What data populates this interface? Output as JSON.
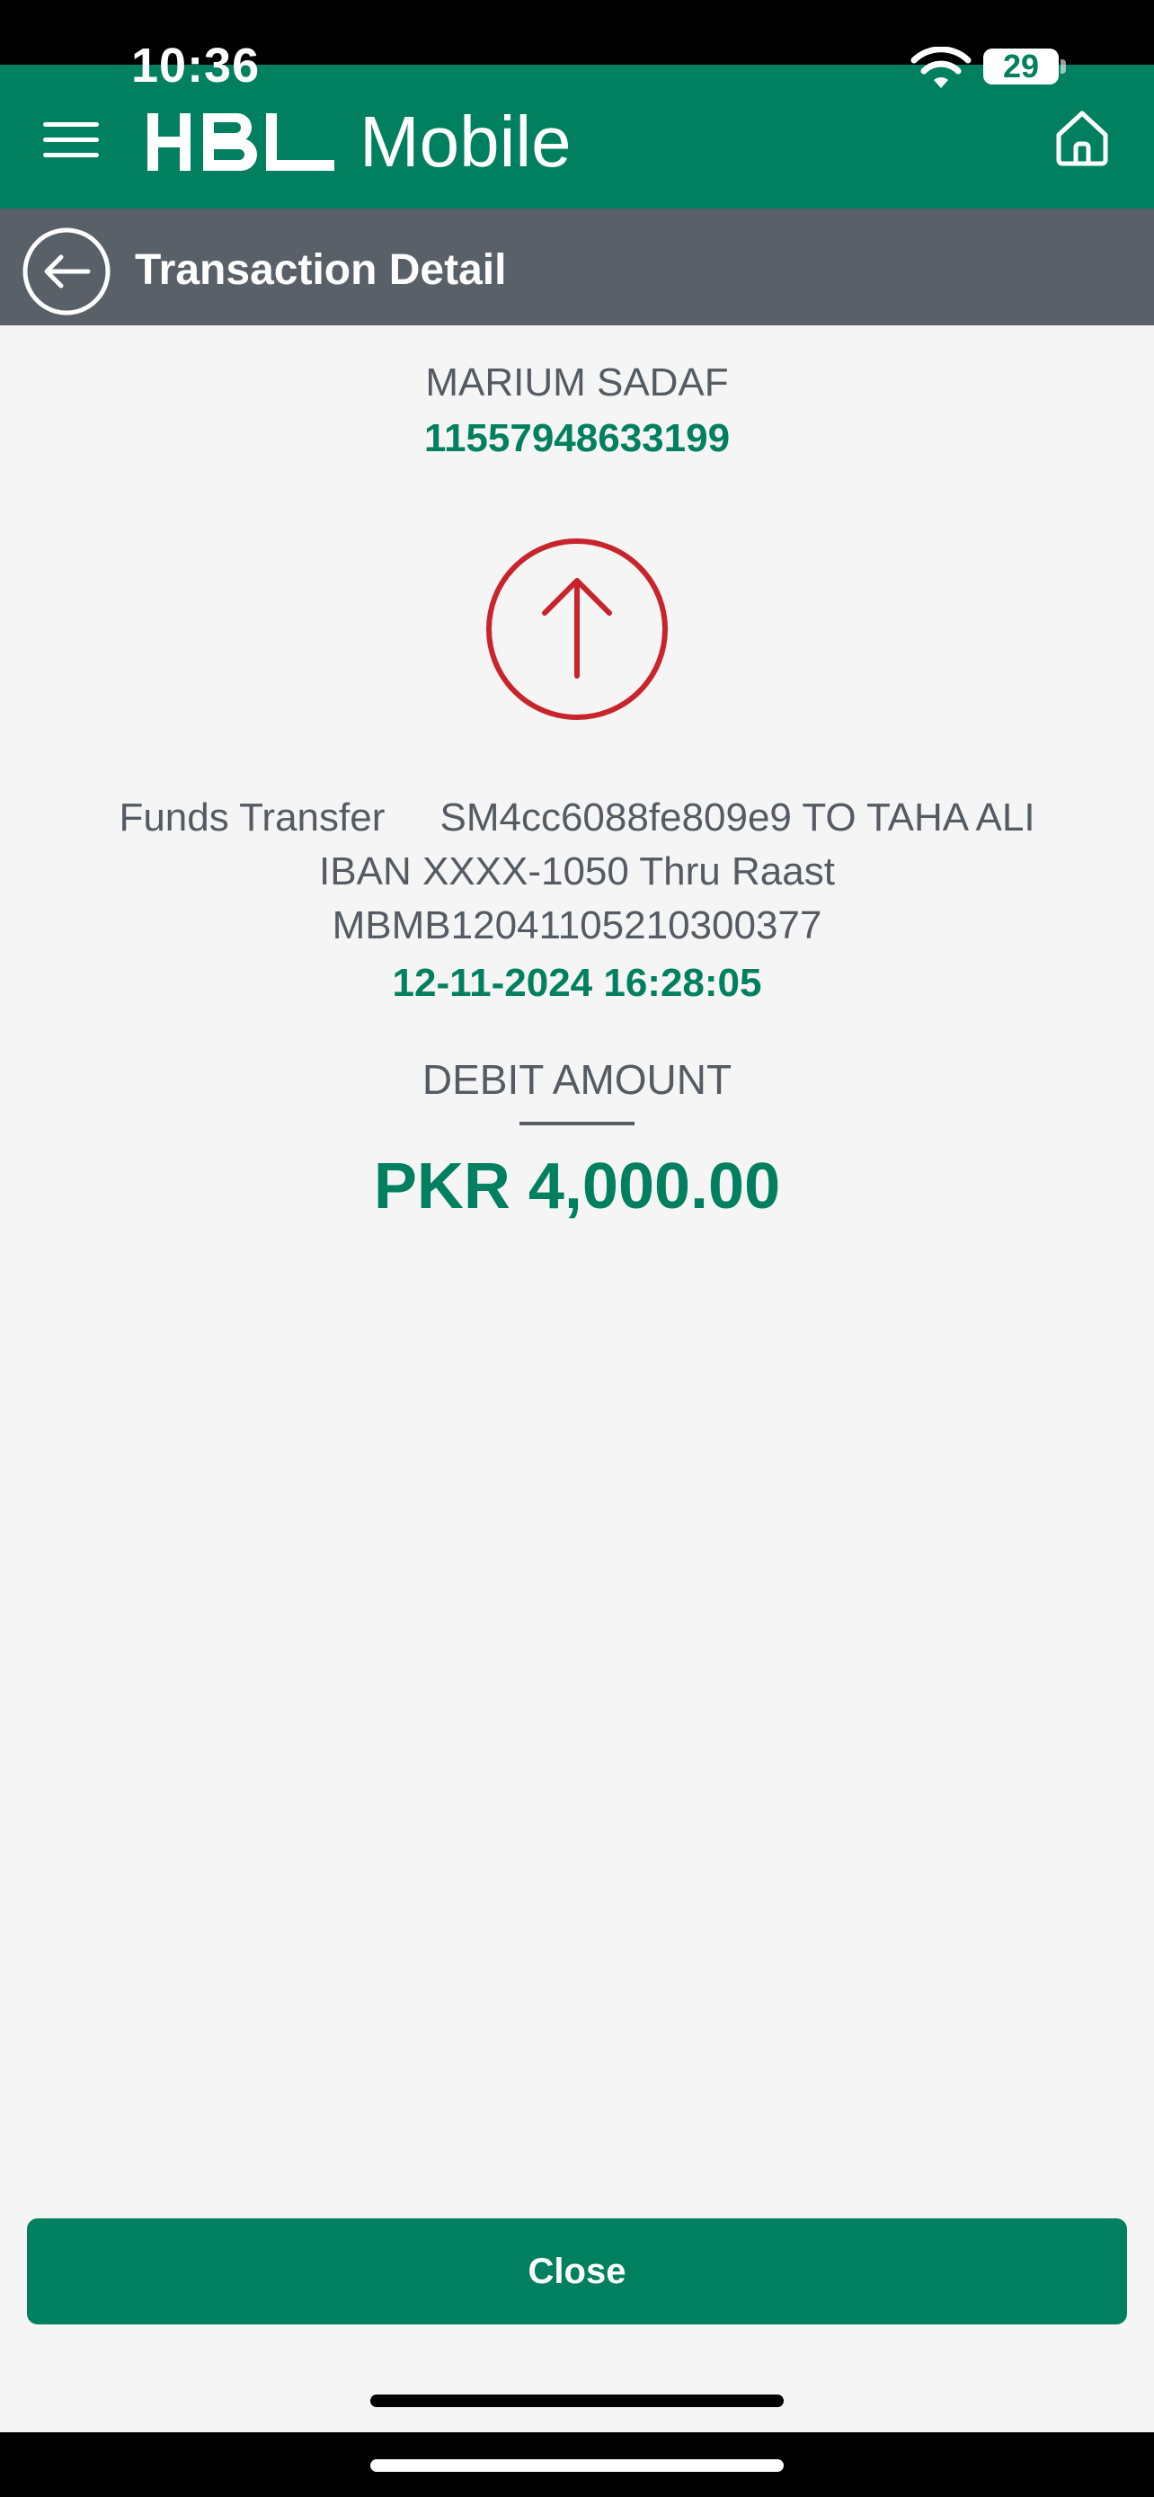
{
  "status_bar": {
    "time": "10:36",
    "battery": "29"
  },
  "header": {
    "logo_mark": "HBL",
    "logo_text": "Mobile"
  },
  "sub_header": {
    "title": "Transaction Detail"
  },
  "transaction": {
    "account_name": "MARIUM SADAF",
    "account_number": "11557948633199",
    "direction_icon": "arrow-up-circle",
    "description_lines": [
      "Funds Transfer     SM4cc6088fe809e9 TO TAHA ALI",
      "IBAN XXXX-1050 Thru Raast",
      "MBMB12041105210300377"
    ],
    "timestamp": "12-11-2024 16:28:05",
    "amount_label": "DEBIT AMOUNT",
    "amount": "PKR 4,000.00"
  },
  "actions": {
    "close_label": "Close"
  },
  "colors": {
    "brand_green": "#00805f",
    "sub_header_gray": "#5a6068",
    "debit_red": "#c8242b",
    "text_gray": "#555b63",
    "background": "#f5f5f5"
  }
}
